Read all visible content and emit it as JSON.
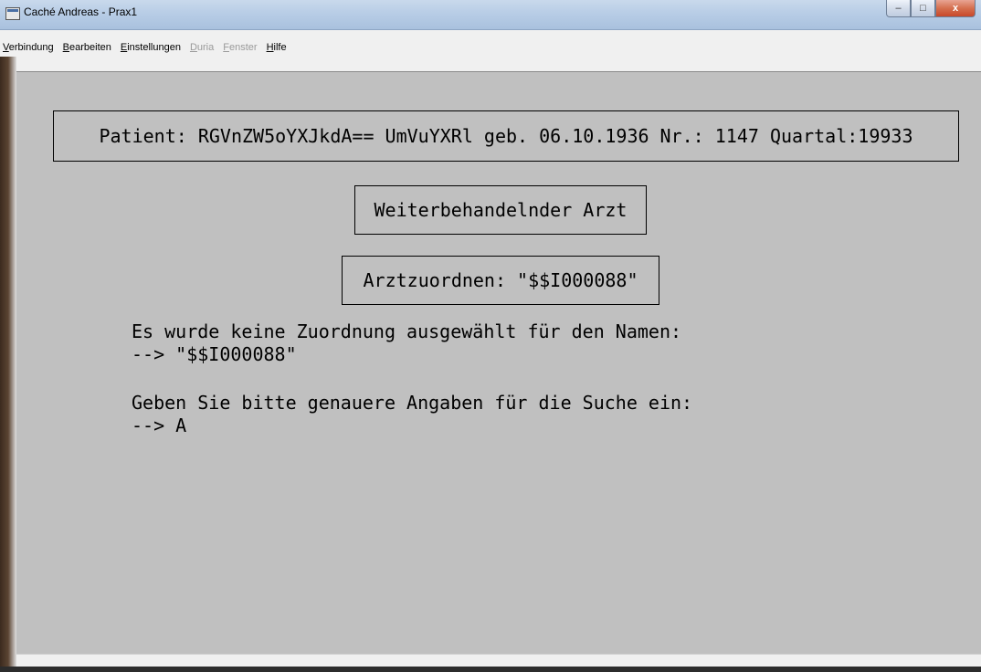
{
  "window": {
    "title": "Caché Andreas - Prax1",
    "controls": {
      "minimize": "–",
      "maximize": "□",
      "close": "x"
    }
  },
  "menu": {
    "items": [
      {
        "label": "Verbindung",
        "accel": "V",
        "rest": "erbindung",
        "enabled": true
      },
      {
        "label": "Bearbeiten",
        "accel": "B",
        "rest": "earbeiten",
        "enabled": true
      },
      {
        "label": "Einstellungen",
        "accel": "E",
        "rest": "instellungen",
        "enabled": true
      },
      {
        "label": "Duria",
        "accel": "D",
        "rest": "uria",
        "enabled": false
      },
      {
        "label": "Fenster",
        "accel": "F",
        "rest": "enster",
        "enabled": false
      },
      {
        "label": "Hilfe",
        "accel": "H",
        "rest": "ilfe",
        "enabled": true
      }
    ]
  },
  "terminal": {
    "background": "#c0c0c0",
    "patient_line": "Patient: RGVnZW5oYXJkdA== UmVuYXRl geb. 06.10.1936 Nr.: 1147 Quartal:19933",
    "heading": "Weiterbehandelnder Arzt",
    "zuordnen": "Arztzuordnen: \"$$I000088\"",
    "message_line1": "Es wurde keine Zuordnung ausgewählt für den Namen:",
    "message_line2": "--> \"$$I000088\"",
    "prompt_line1": "Geben Sie bitte genauere Angaben für die Suche ein:",
    "prompt_line2": "--> A"
  }
}
